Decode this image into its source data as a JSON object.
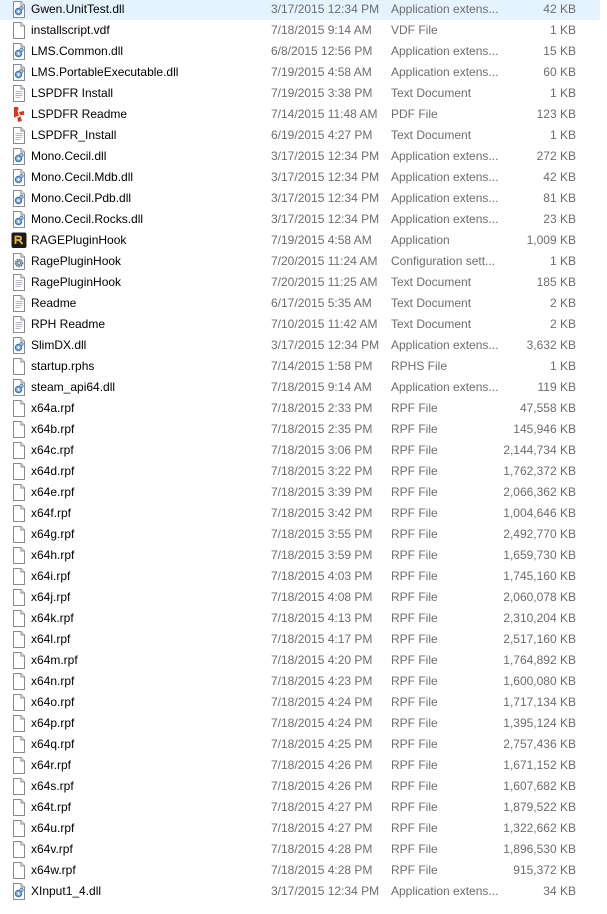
{
  "files": [
    {
      "name": "Gwen.UnitTest.dll",
      "date": "3/17/2015 12:34 PM",
      "type": "Application extens...",
      "size": "42 KB",
      "icon": "dll-icon"
    },
    {
      "name": "installscript.vdf",
      "date": "7/18/2015 9:14 AM",
      "type": "VDF File",
      "size": "1 KB",
      "icon": "generic-file-icon"
    },
    {
      "name": "LMS.Common.dll",
      "date": "6/8/2015 12:56 PM",
      "type": "Application extens...",
      "size": "15 KB",
      "icon": "dll-icon"
    },
    {
      "name": "LMS.PortableExecutable.dll",
      "date": "7/19/2015 4:58 AM",
      "type": "Application extens...",
      "size": "60 KB",
      "icon": "dll-icon"
    },
    {
      "name": "LSPDFR Install",
      "date": "7/19/2015 3:38 PM",
      "type": "Text Document",
      "size": "1 KB",
      "icon": "text-document-icon"
    },
    {
      "name": "LSPDFR Readme",
      "date": "7/14/2015 11:48 AM",
      "type": "PDF File",
      "size": "123 KB",
      "icon": "pdf-icon"
    },
    {
      "name": "LSPDFR_Install",
      "date": "6/19/2015 4:27 PM",
      "type": "Text Document",
      "size": "1 KB",
      "icon": "text-document-icon"
    },
    {
      "name": "Mono.Cecil.dll",
      "date": "3/17/2015 12:34 PM",
      "type": "Application extens...",
      "size": "272 KB",
      "icon": "dll-icon"
    },
    {
      "name": "Mono.Cecil.Mdb.dll",
      "date": "3/17/2015 12:34 PM",
      "type": "Application extens...",
      "size": "42 KB",
      "icon": "dll-icon"
    },
    {
      "name": "Mono.Cecil.Pdb.dll",
      "date": "3/17/2015 12:34 PM",
      "type": "Application extens...",
      "size": "81 KB",
      "icon": "dll-icon"
    },
    {
      "name": "Mono.Cecil.Rocks.dll",
      "date": "3/17/2015 12:34 PM",
      "type": "Application extens...",
      "size": "23 KB",
      "icon": "dll-icon"
    },
    {
      "name": "RAGEPluginHook",
      "date": "7/19/2015 4:58 AM",
      "type": "Application",
      "size": "1,009 KB",
      "icon": "rage-app-icon"
    },
    {
      "name": "RagePluginHook",
      "date": "7/20/2015 11:24 AM",
      "type": "Configuration sett...",
      "size": "1 KB",
      "icon": "config-gear-icon"
    },
    {
      "name": "RagePluginHook",
      "date": "7/20/2015 11:25 AM",
      "type": "Text Document",
      "size": "185 KB",
      "icon": "text-document-icon"
    },
    {
      "name": "Readme",
      "date": "6/17/2015 5:35 AM",
      "type": "Text Document",
      "size": "2 KB",
      "icon": "text-document-icon"
    },
    {
      "name": "RPH Readme",
      "date": "7/10/2015 11:42 AM",
      "type": "Text Document",
      "size": "2 KB",
      "icon": "text-document-icon"
    },
    {
      "name": "SlimDX.dll",
      "date": "3/17/2015 12:34 PM",
      "type": "Application extens...",
      "size": "3,632 KB",
      "icon": "dll-icon"
    },
    {
      "name": "startup.rphs",
      "date": "7/14/2015 1:58 PM",
      "type": "RPHS File",
      "size": "1 KB",
      "icon": "generic-file-icon"
    },
    {
      "name": "steam_api64.dll",
      "date": "7/18/2015 9:14 AM",
      "type": "Application extens...",
      "size": "119 KB",
      "icon": "dll-icon"
    },
    {
      "name": "x64a.rpf",
      "date": "7/18/2015 2:33 PM",
      "type": "RPF File",
      "size": "47,558 KB",
      "icon": "generic-file-icon"
    },
    {
      "name": "x64b.rpf",
      "date": "7/18/2015 2:35 PM",
      "type": "RPF File",
      "size": "145,946 KB",
      "icon": "generic-file-icon"
    },
    {
      "name": "x64c.rpf",
      "date": "7/18/2015 3:06 PM",
      "type": "RPF File",
      "size": "2,144,734 KB",
      "icon": "generic-file-icon"
    },
    {
      "name": "x64d.rpf",
      "date": "7/18/2015 3:22 PM",
      "type": "RPF File",
      "size": "1,762,372 KB",
      "icon": "generic-file-icon"
    },
    {
      "name": "x64e.rpf",
      "date": "7/18/2015 3:39 PM",
      "type": "RPF File",
      "size": "2,066,362 KB",
      "icon": "generic-file-icon"
    },
    {
      "name": "x64f.rpf",
      "date": "7/18/2015 3:42 PM",
      "type": "RPF File",
      "size": "1,004,646 KB",
      "icon": "generic-file-icon"
    },
    {
      "name": "x64g.rpf",
      "date": "7/18/2015 3:55 PM",
      "type": "RPF File",
      "size": "2,492,770 KB",
      "icon": "generic-file-icon"
    },
    {
      "name": "x64h.rpf",
      "date": "7/18/2015 3:59 PM",
      "type": "RPF File",
      "size": "1,659,730 KB",
      "icon": "generic-file-icon"
    },
    {
      "name": "x64i.rpf",
      "date": "7/18/2015 4:03 PM",
      "type": "RPF File",
      "size": "1,745,160 KB",
      "icon": "generic-file-icon"
    },
    {
      "name": "x64j.rpf",
      "date": "7/18/2015 4:08 PM",
      "type": "RPF File",
      "size": "2,060,078 KB",
      "icon": "generic-file-icon"
    },
    {
      "name": "x64k.rpf",
      "date": "7/18/2015 4:13 PM",
      "type": "RPF File",
      "size": "2,310,204 KB",
      "icon": "generic-file-icon"
    },
    {
      "name": "x64l.rpf",
      "date": "7/18/2015 4:17 PM",
      "type": "RPF File",
      "size": "2,517,160 KB",
      "icon": "generic-file-icon"
    },
    {
      "name": "x64m.rpf",
      "date": "7/18/2015 4:20 PM",
      "type": "RPF File",
      "size": "1,764,892 KB",
      "icon": "generic-file-icon"
    },
    {
      "name": "x64n.rpf",
      "date": "7/18/2015 4:23 PM",
      "type": "RPF File",
      "size": "1,600,080 KB",
      "icon": "generic-file-icon"
    },
    {
      "name": "x64o.rpf",
      "date": "7/18/2015 4:24 PM",
      "type": "RPF File",
      "size": "1,717,134 KB",
      "icon": "generic-file-icon"
    },
    {
      "name": "x64p.rpf",
      "date": "7/18/2015 4:24 PM",
      "type": "RPF File",
      "size": "1,395,124 KB",
      "icon": "generic-file-icon"
    },
    {
      "name": "x64q.rpf",
      "date": "7/18/2015 4:25 PM",
      "type": "RPF File",
      "size": "2,757,436 KB",
      "icon": "generic-file-icon"
    },
    {
      "name": "x64r.rpf",
      "date": "7/18/2015 4:26 PM",
      "type": "RPF File",
      "size": "1,671,152 KB",
      "icon": "generic-file-icon"
    },
    {
      "name": "x64s.rpf",
      "date": "7/18/2015 4:26 PM",
      "type": "RPF File",
      "size": "1,607,682 KB",
      "icon": "generic-file-icon"
    },
    {
      "name": "x64t.rpf",
      "date": "7/18/2015 4:27 PM",
      "type": "RPF File",
      "size": "1,879,522 KB",
      "icon": "generic-file-icon"
    },
    {
      "name": "x64u.rpf",
      "date": "7/18/2015 4:27 PM",
      "type": "RPF File",
      "size": "1,322,662 KB",
      "icon": "generic-file-icon"
    },
    {
      "name": "x64v.rpf",
      "date": "7/18/2015 4:28 PM",
      "type": "RPF File",
      "size": "1,896,530 KB",
      "icon": "generic-file-icon"
    },
    {
      "name": "x64w.rpf",
      "date": "7/18/2015 4:28 PM",
      "type": "RPF File",
      "size": "915,372 KB",
      "icon": "generic-file-icon"
    },
    {
      "name": "XInput1_4.dll",
      "date": "3/17/2015 12:34 PM",
      "type": "Application extens...",
      "size": "34 KB",
      "icon": "dll-icon"
    }
  ]
}
